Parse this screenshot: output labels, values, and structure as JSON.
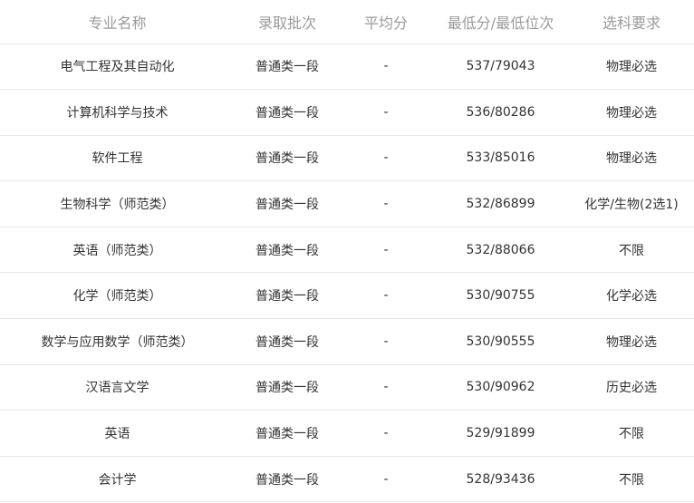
{
  "headers": {
    "major": "专业名称",
    "batch": "录取批次",
    "avg": "平均分",
    "min": "最低分/最低位次",
    "requirement": "选科要求"
  },
  "rows": [
    {
      "major": "电气工程及其自动化",
      "batch": "普通类一段",
      "avg": "-",
      "min": "537/79043",
      "requirement": "物理必选"
    },
    {
      "major": "计算机科学与技术",
      "batch": "普通类一段",
      "avg": "-",
      "min": "536/80286",
      "requirement": "物理必选"
    },
    {
      "major": "软件工程",
      "batch": "普通类一段",
      "avg": "-",
      "min": "533/85016",
      "requirement": "物理必选"
    },
    {
      "major": "生物科学（师范类）",
      "batch": "普通类一段",
      "avg": "-",
      "min": "532/86899",
      "requirement": "化学/生物(2选1)"
    },
    {
      "major": "英语（师范类）",
      "batch": "普通类一段",
      "avg": "-",
      "min": "532/88066",
      "requirement": "不限"
    },
    {
      "major": "化学（师范类）",
      "batch": "普通类一段",
      "avg": "-",
      "min": "530/90755",
      "requirement": "化学必选"
    },
    {
      "major": "数学与应用数学（师范类）",
      "batch": "普通类一段",
      "avg": "-",
      "min": "530/90555",
      "requirement": "物理必选"
    },
    {
      "major": "汉语言文学",
      "batch": "普通类一段",
      "avg": "-",
      "min": "530/90962",
      "requirement": "历史必选"
    },
    {
      "major": "英语",
      "batch": "普通类一段",
      "avg": "-",
      "min": "529/91899",
      "requirement": "不限"
    },
    {
      "major": "会计学",
      "batch": "普通类一段",
      "avg": "-",
      "min": "528/93436",
      "requirement": "不限"
    }
  ]
}
